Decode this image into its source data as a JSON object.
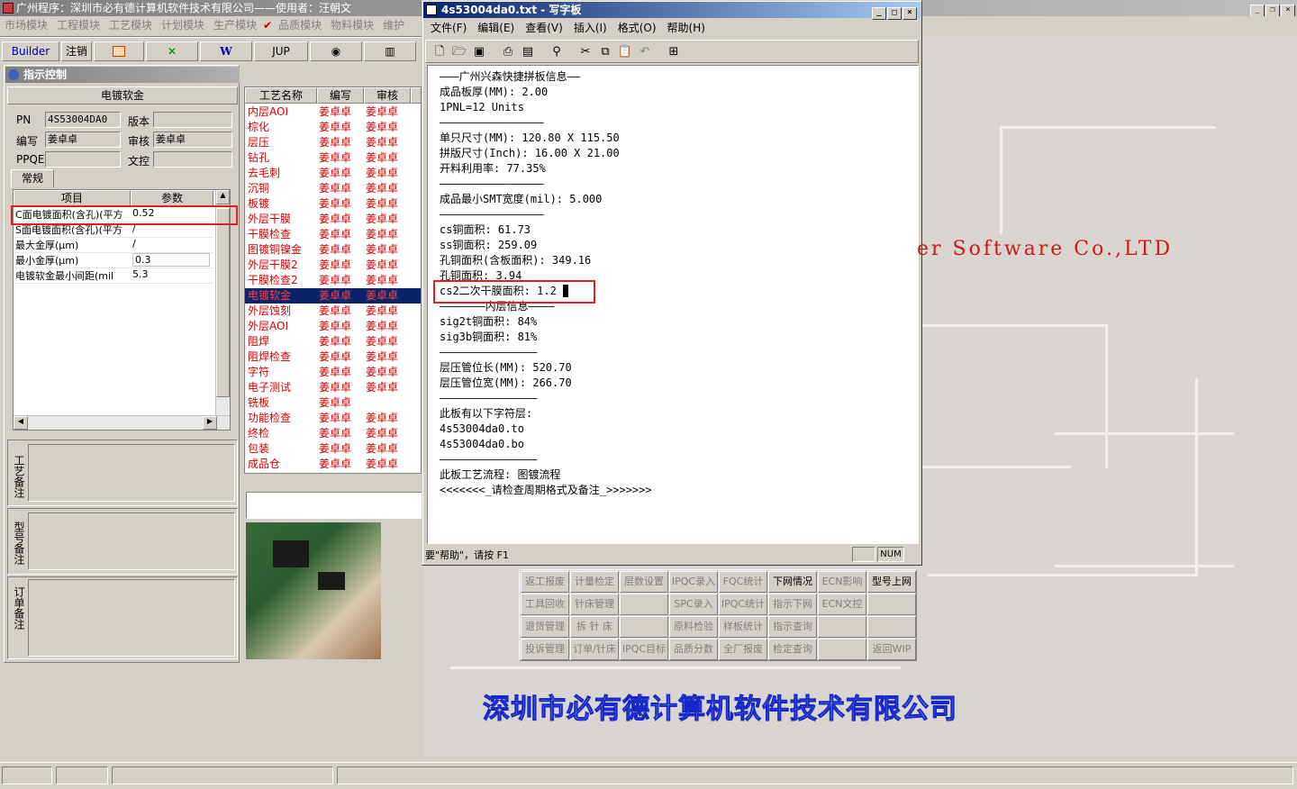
{
  "main_window": {
    "title": "广州程序：深圳市必有德计算机软件技术有限公司——使用者：汪朝文",
    "menu": [
      "市场模块",
      "工程模块",
      "工艺模块",
      "计划模块",
      "生产模块",
      "品质模块",
      "物料模块",
      "维护"
    ]
  },
  "toolbar": {
    "builder": "Builder",
    "logout": "注销",
    "jup": "JUP"
  },
  "watermark": {
    "english": "er Software Co.,LTD",
    "company": "深圳市必有德计算机软件技术有限公司"
  },
  "instruction_panel": {
    "title": "指示控制",
    "header": "电镀软金",
    "fields": {
      "pn_label": "PN",
      "pn_value": "4S53004DA0",
      "version_label": "版本",
      "version_value": "",
      "author_label": "编写",
      "author_value": "姜卓卓",
      "review_label": "审核",
      "review_value": "姜卓卓",
      "ppqe_label": "PPQE",
      "ppqe_value": "",
      "doc_control_label": "文控",
      "doc_control_value": ""
    },
    "tab": "常规",
    "grid_headers": [
      "项目",
      "参数"
    ],
    "grid_rows": [
      {
        "item": "C面电镀面积(含孔)(平方",
        "param": "0.52"
      },
      {
        "item": "S面电镀面积(含孔)(平方",
        "param": "/"
      },
      {
        "item": "最大金厚(μm)",
        "param": "/"
      },
      {
        "item": "最小金厚(μm)",
        "param": "0.3"
      },
      {
        "item": "电镀软金最小间距(mil",
        "param": "5.3"
      }
    ],
    "notes": [
      "工艺备注",
      "型号备注",
      "订单备注"
    ]
  },
  "process_table": {
    "headers": [
      "工艺名称",
      "编写",
      "审核"
    ],
    "rows": [
      {
        "name": "内层AOI",
        "author": "姜卓卓",
        "review": "姜卓卓"
      },
      {
        "name": "棕化",
        "author": "姜卓卓",
        "review": "姜卓卓"
      },
      {
        "name": "层压",
        "author": "姜卓卓",
        "review": "姜卓卓"
      },
      {
        "name": "钻孔",
        "author": "姜卓卓",
        "review": "姜卓卓"
      },
      {
        "name": "去毛刺",
        "author": "姜卓卓",
        "review": "姜卓卓"
      },
      {
        "name": "沉铜",
        "author": "姜卓卓",
        "review": "姜卓卓"
      },
      {
        "name": "板镀",
        "author": "姜卓卓",
        "review": "姜卓卓"
      },
      {
        "name": "外层干膜",
        "author": "姜卓卓",
        "review": "姜卓卓"
      },
      {
        "name": "干膜检查",
        "author": "姜卓卓",
        "review": "姜卓卓"
      },
      {
        "name": "图镀铜镍金",
        "author": "姜卓卓",
        "review": "姜卓卓"
      },
      {
        "name": "外层干膜2",
        "author": "姜卓卓",
        "review": "姜卓卓"
      },
      {
        "name": "干膜检查2",
        "author": "姜卓卓",
        "review": "姜卓卓"
      },
      {
        "name": "电镀软金",
        "author": "姜卓卓",
        "review": "姜卓卓"
      },
      {
        "name": "外层蚀刻",
        "author": "姜卓卓",
        "review": "姜卓卓"
      },
      {
        "name": "外层AOI",
        "author": "姜卓卓",
        "review": "姜卓卓"
      },
      {
        "name": "阻焊",
        "author": "姜卓卓",
        "review": "姜卓卓"
      },
      {
        "name": "阻焊检查",
        "author": "姜卓卓",
        "review": "姜卓卓"
      },
      {
        "name": "字符",
        "author": "姜卓卓",
        "review": "姜卓卓"
      },
      {
        "name": "电子测试",
        "author": "姜卓卓",
        "review": "姜卓卓"
      },
      {
        "name": "铣板",
        "author": "姜卓卓",
        "review": ""
      },
      {
        "name": "功能检查",
        "author": "姜卓卓",
        "review": "姜卓卓"
      },
      {
        "name": "终检",
        "author": "姜卓卓",
        "review": "姜卓卓"
      },
      {
        "name": "包装",
        "author": "姜卓卓",
        "review": "姜卓卓"
      },
      {
        "name": "成品仓",
        "author": "姜卓卓",
        "review": "姜卓卓"
      }
    ],
    "selected_index": 12
  },
  "wordpad": {
    "title": "4s53004da0.txt - 写字板",
    "menu": [
      "文件(F)",
      "编辑(E)",
      "查看(V)",
      "插入(I)",
      "格式(O)",
      "帮助(H)"
    ],
    "lines": [
      "———广州兴森快捷拼板信息——",
      "成品板厚(MM): 2.00",
      "1PNL=12 Units",
      "————————————————",
      "单只尺寸(MM): 120.80 X 115.50",
      "拼版尺寸(Inch): 16.00 X 21.00",
      "开料利用率: 77.35%",
      "————————————————",
      "成品最小SMT宽度(mil): 5.000",
      "————————————————",
      "cs铜面积: 61.73",
      "ss铜面积: 259.09",
      "孔铜面积(含板面积): 349.16",
      "孔铜面积: 3.94",
      "cs2二次干膜面积: 1.2",
      "———————内层信息————",
      "sig2t铜面积: 84%",
      "sig3b铜面积: 81%",
      "———————————————",
      "层压管位长(MM): 520.70",
      "层压管位宽(MM): 266.70",
      "———————————————",
      "此板有以下字符层:",
      "4s53004da0.to",
      "4s53004da0.bo",
      "———————————————",
      "此板工艺流程: 图镀流程",
      "<<<<<<<_请检查周期格式及备注_>>>>>>>"
    ],
    "status_help": "要\"帮助\"，请按 F1",
    "status_num": "NUM"
  },
  "button_grid": [
    [
      "返工报废",
      "计量检定",
      "层数设置",
      "IPQC录入",
      "FQC统计",
      "下网情况",
      "ECN影响",
      "型号上网"
    ],
    [
      "工具回收",
      "针床管理",
      "",
      "SPC录入",
      "IPQC统计",
      "指示下网",
      "ECN文控",
      ""
    ],
    [
      "退货管理",
      "拆 针 床",
      "",
      "原料检验",
      "样板统计",
      "指示查询",
      "",
      ""
    ],
    [
      "投诉管理",
      "订单/针床",
      "IPQC目标",
      "品质分数",
      "全厂报废",
      "检定查询",
      "",
      "返回WIP"
    ]
  ],
  "button_grid_active": [
    "下网情况",
    "型号上网"
  ]
}
